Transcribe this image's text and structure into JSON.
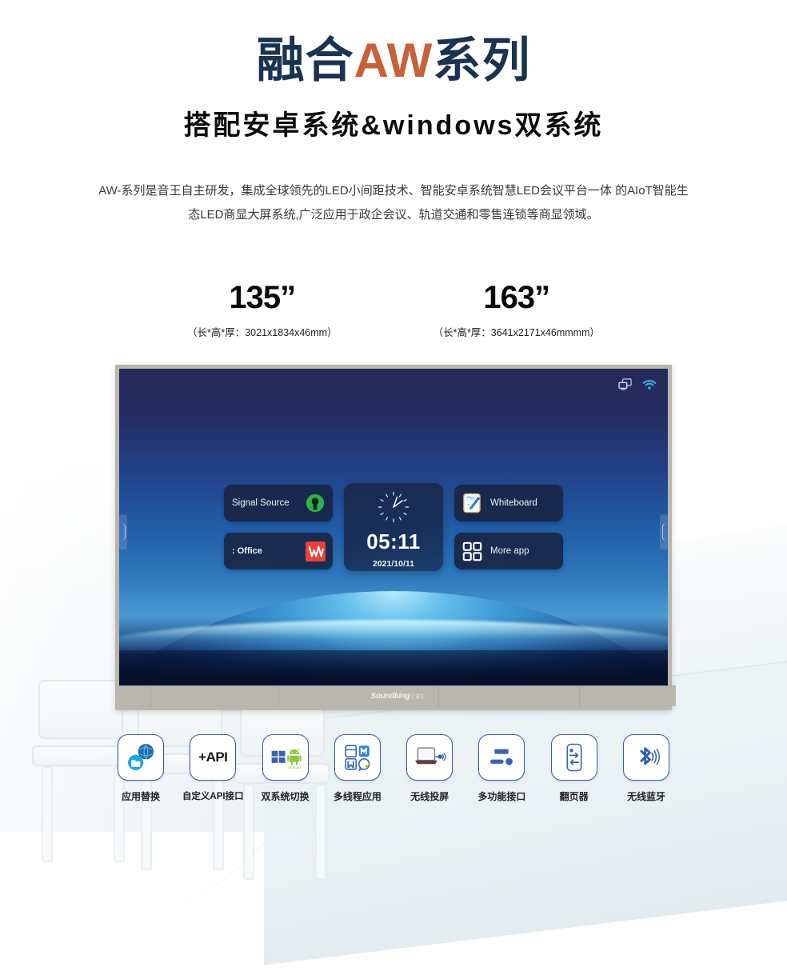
{
  "hero": {
    "title_part1": "融合",
    "title_aw": "AW",
    "title_part2": "系列",
    "subtitle": "搭配安卓系统&windows双系统",
    "description_line1": "AW-系列是音王自主研发，集成全球领先的LED小间距技术、智能安卓系统智慧LED会议平台一体",
    "description_line2": "的AIoT智能生态LED商显大屏系统,广泛应用于政企会议、轨道交通和零售连锁等商显领域。",
    "colors": {
      "navy": "#1b3350",
      "orange": "#c8603a",
      "black": "#0c0c0c"
    }
  },
  "sizes": [
    {
      "inches": "135”",
      "dimensions": "（长*高*厚：3021x1834x46mm）"
    },
    {
      "inches": "163”",
      "dimensions": "（长*高*厚：3641x2171x46mmmm）"
    }
  ],
  "device": {
    "statusbar": [
      {
        "icon": "screen-cast-icon"
      },
      {
        "icon": "wifi-icon",
        "color": "#3da8e8"
      }
    ],
    "tiles": [
      {
        "label": "Signal Source",
        "icon": "signal-source-icon",
        "icon_color": "#2cb34a"
      },
      {
        "label": ": Office",
        "icon": "wps-office-icon",
        "icon_color": "#e8433b"
      },
      {
        "label": "Whiteboard",
        "icon": "whiteboard-icon"
      },
      {
        "label": "More app",
        "icon": "grid-apps-icon"
      }
    ],
    "clock": {
      "time": "05:11",
      "date": "2021/10/11"
    },
    "brand": {
      "name": "Soundking",
      "cn": "音王"
    }
  },
  "features": [
    {
      "label": "应用替换",
      "icon": "app-replace-icon"
    },
    {
      "label": "自定义API接口",
      "icon": "api-icon",
      "text": "+API"
    },
    {
      "label": "双系统切换",
      "icon": "dual-system-icon"
    },
    {
      "label": "多线程应用",
      "icon": "multithread-apps-icon"
    },
    {
      "label": "无线投屏",
      "icon": "wireless-cast-icon"
    },
    {
      "label": "多功能接口",
      "icon": "multi-port-icon"
    },
    {
      "label": "翻页器",
      "icon": "page-turner-icon"
    },
    {
      "label": "无线蓝牙",
      "icon": "bluetooth-icon"
    }
  ]
}
